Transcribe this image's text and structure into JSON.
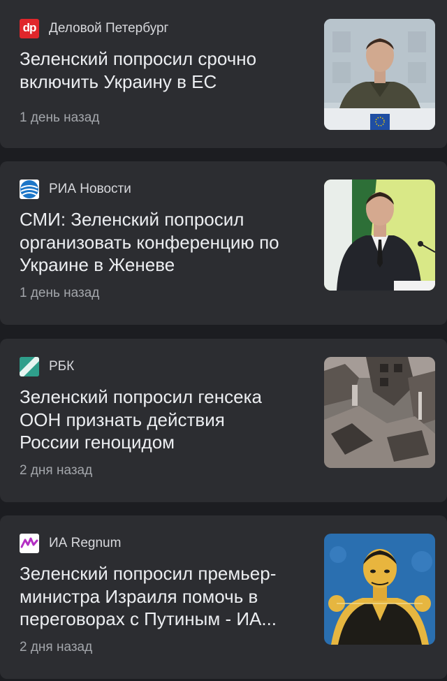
{
  "articles": [
    {
      "source": "Деловой Петербург",
      "logo_text": "dp",
      "logo_color": "#e0262b",
      "headline": "Зеленский попросил срочно\nвключить Украину в ЕС",
      "time": "1 день назад",
      "thumbnail": "press-briefing-photo"
    },
    {
      "source": "РИА Новости",
      "logo_color": "#1c76c8",
      "headline": "СМИ: Зеленский попросил\nорганизовать конференцию по\nУкраине в Женеве",
      "time": "1 день назад",
      "thumbnail": "speaker-at-podium-photo"
    },
    {
      "source": "РБК",
      "logo_color": "#2f9f8b",
      "headline": "Зеленский попросил генсека\nООН признать действия\nРоссии геноцидом",
      "time": "2 дня назад",
      "thumbnail": "destroyed-building-photo"
    },
    {
      "source": "ИА Regnum",
      "logo_color": "#b32fc4",
      "headline": "Зеленский попросил премьер-\nминистра Израиля помочь в\nпереговорах с Путиным - ИА...",
      "time": "2 дня назад",
      "thumbnail": "duotone-portrait-photo"
    }
  ]
}
